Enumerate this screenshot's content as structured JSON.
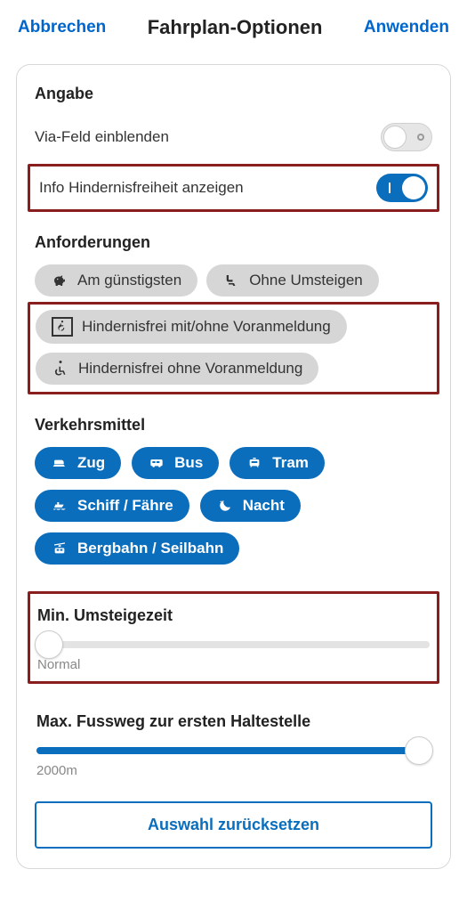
{
  "topbar": {
    "cancel": "Abbrechen",
    "title": "Fahrplan-Optionen",
    "apply": "Anwenden"
  },
  "sections": {
    "angabe": {
      "title": "Angabe",
      "via_label": "Via-Feld einblenden",
      "via_on": false,
      "hinder_label": "Info Hindernisfreiheit anzeigen",
      "hinder_on": true
    },
    "anforderungen": {
      "title": "Anforderungen",
      "chips": {
        "cheapest": "Am günstigsten",
        "no_transfer": "Ohne Umsteigen",
        "barrier_with": "Hindernisfrei mit/ohne Voranmeldung",
        "barrier_without": "Hindernisfrei ohne Voranmeldung"
      }
    },
    "verkehrsmittel": {
      "title": "Verkehrsmittel",
      "chips": {
        "zug": "Zug",
        "bus": "Bus",
        "tram": "Tram",
        "schiff": "Schiff / Fähre",
        "nacht": "Nacht",
        "bergbahn": "Bergbahn / Seilbahn"
      }
    },
    "umsteigezeit": {
      "title": "Min. Umsteigezeit",
      "value_label": "Normal",
      "percent": 0
    },
    "fussweg": {
      "title": "Max. Fussweg zur ersten Haltestelle",
      "value_label": "2000m",
      "percent": 100
    }
  },
  "reset_label": "Auswahl zurücksetzen"
}
